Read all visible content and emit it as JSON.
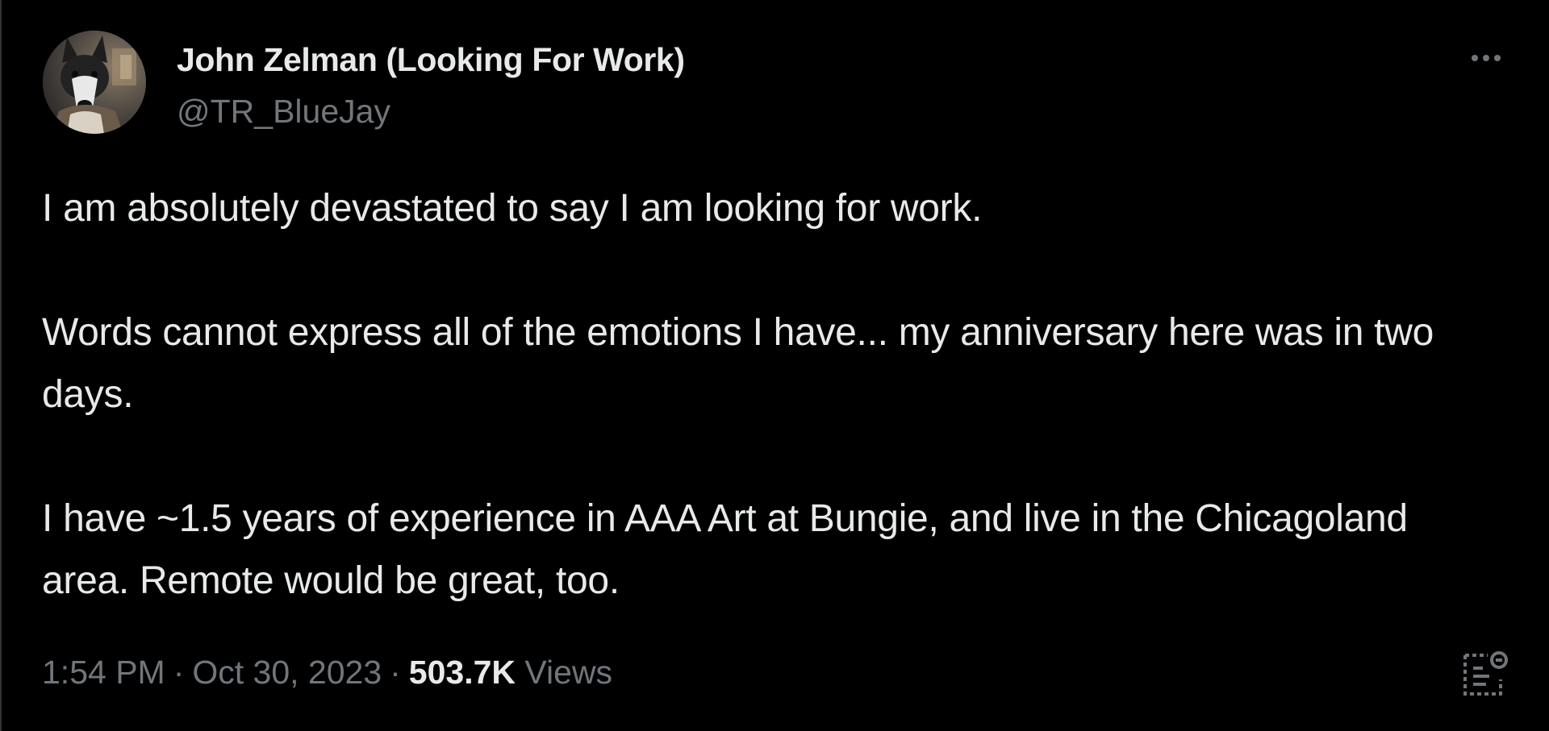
{
  "author": {
    "display_name": "John Zelman (Looking For Work)",
    "handle": "@TR_BlueJay"
  },
  "post": {
    "paragraphs": [
      "I am absolutely devastated to say I am looking for work.",
      "Words cannot express all of the emotions I have... my anniversary here was in two days.",
      "I have ~1.5 years of experience in AAA Art at Bungie, and live in the Chicagoland area. Remote would be great, too."
    ]
  },
  "meta": {
    "time": "1:54 PM",
    "separator": "·",
    "date": "Oct 30, 2023",
    "views_count": "503.7K",
    "views_label": "Views"
  },
  "icons": {
    "more": "more-horizontal-icon",
    "analytics": "post-analytics-icon"
  },
  "colors": {
    "background": "#000000",
    "primary_text": "#e7e9ea",
    "secondary_text": "#71767b"
  }
}
